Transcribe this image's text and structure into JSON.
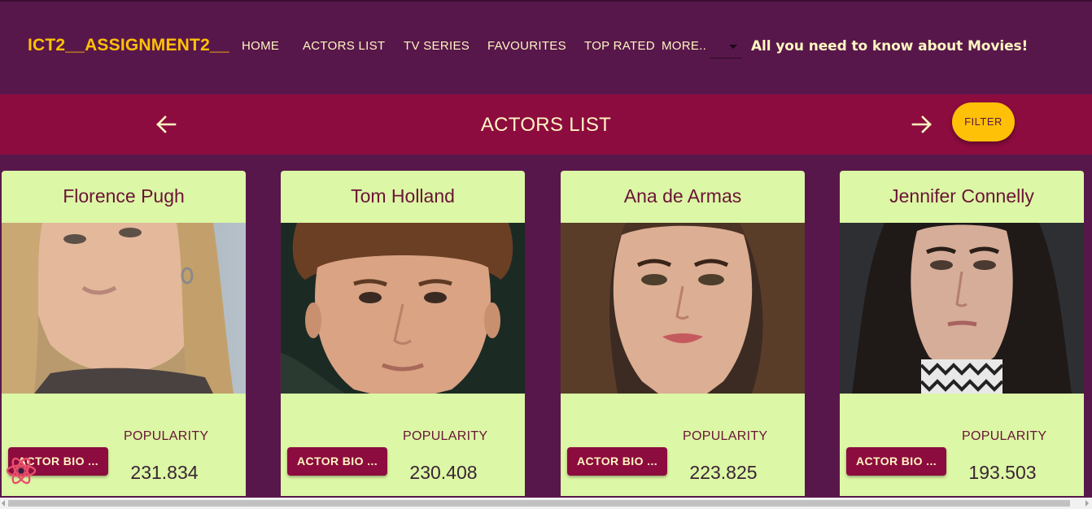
{
  "app": {
    "brand": "ICT2__ASSIGNMENT2__",
    "nav": [
      "HOME",
      "ACTORS LIST",
      "TV SERIES",
      "FAVOURITES",
      "TOP RATED",
      "MORE.."
    ],
    "tagline": "All you need to know about Movies!"
  },
  "list_header": {
    "title": "ACTORS LIST",
    "filter_label": "FILTER"
  },
  "colors": {
    "background": "#58174a",
    "header_bar": "#8d0c3f",
    "accent": "#ffc107",
    "card": "#dcf7a5",
    "text_light": "#fff6c2"
  },
  "actors": [
    {
      "name": "Florence Pugh",
      "popularity_label": "POPULARITY",
      "popularity": "231.834",
      "bio_button": "ACTOR BIO ..."
    },
    {
      "name": "Tom Holland",
      "popularity_label": "POPULARITY",
      "popularity": "230.408",
      "bio_button": "ACTOR BIO ..."
    },
    {
      "name": "Ana de Armas",
      "popularity_label": "POPULARITY",
      "popularity": "223.825",
      "bio_button": "ACTOR BIO ..."
    },
    {
      "name": "Jennifer Connelly",
      "popularity_label": "POPULARITY",
      "popularity": "193.503",
      "bio_button": "ACTOR BIO ..."
    }
  ],
  "icons": {
    "prev": "arrow-left-icon",
    "next": "arrow-right-icon",
    "dev_tools": "react-logo-icon"
  }
}
